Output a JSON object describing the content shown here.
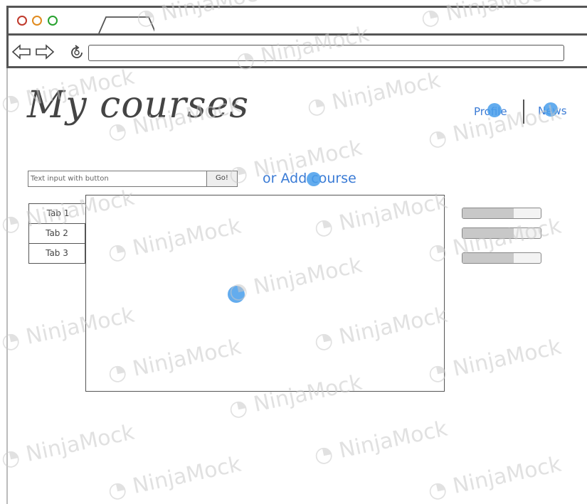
{
  "window": {
    "address": ""
  },
  "header": {
    "title": "My courses",
    "links": [
      {
        "label": "Profile"
      },
      {
        "label": "News"
      }
    ]
  },
  "search": {
    "placeholder": "Text input with button",
    "value": "",
    "button_label": "Go!"
  },
  "add_course": {
    "prefix": "or",
    "label": "Add course"
  },
  "tabs": [
    {
      "label": "Tab 1",
      "active": true
    },
    {
      "label": "Tab 2",
      "active": false
    },
    {
      "label": "Tab 3",
      "active": false
    }
  ],
  "progress_bars": [
    {
      "value": 0.65
    },
    {
      "value": 0.65
    },
    {
      "value": 0.65
    }
  ],
  "watermark": {
    "text": "NinjaMock"
  },
  "colors": {
    "link": "#3a7bd5",
    "hotspot": "#489deb",
    "frame": "#555555"
  }
}
